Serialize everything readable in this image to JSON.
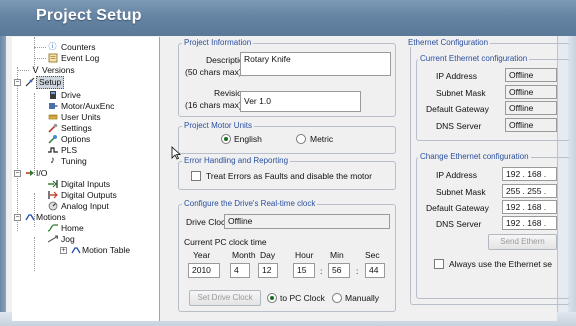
{
  "window": {
    "title": "Project Setup"
  },
  "tree": {
    "items": [
      {
        "label": "Counters",
        "icon": "info-icon"
      },
      {
        "label": "Event Log",
        "icon": "log-icon"
      },
      {
        "label": "Versions",
        "icon": "versions-icon"
      },
      {
        "label": "Setup",
        "icon": "setup-icon",
        "selected": true
      },
      {
        "label": "Drive",
        "icon": "drive-icon"
      },
      {
        "label": "Motor/AuxEnc",
        "icon": "motor-icon"
      },
      {
        "label": "User Units",
        "icon": "units-icon"
      },
      {
        "label": "Settings",
        "icon": "settings-icon"
      },
      {
        "label": "Options",
        "icon": "options-icon"
      },
      {
        "label": "PLS",
        "icon": "pls-icon"
      },
      {
        "label": "Tuning",
        "icon": "tuning-icon"
      },
      {
        "label": "I/O",
        "icon": "io-icon"
      },
      {
        "label": "Digital Inputs",
        "icon": "digital-inputs-icon"
      },
      {
        "label": "Digital Outputs",
        "icon": "digital-outputs-icon"
      },
      {
        "label": "Analog Input",
        "icon": "analog-input-icon"
      },
      {
        "label": "Motions",
        "icon": "motions-icon"
      },
      {
        "label": "Home",
        "icon": "home-icon"
      },
      {
        "label": "Jog",
        "icon": "jog-icon"
      },
      {
        "label": "Motion Table",
        "icon": "motion-table-icon"
      }
    ]
  },
  "project_info": {
    "legend": "Project Information",
    "description_label_1": "Description",
    "description_label_2": "(50 chars max)",
    "description_value": "Rotary Knife",
    "revision_label_1": "Revision",
    "revision_label_2": "(16 chars max)",
    "revision_value": "Ver 1.0"
  },
  "motor_units": {
    "legend": "Project Motor Units",
    "english": "English",
    "metric": "Metric",
    "selected": "English"
  },
  "error_handling": {
    "legend": "Error Handling and Reporting",
    "checkbox_label": "Treat Errors as Faults and disable the motor",
    "checked": false
  },
  "clock": {
    "legend": "Configure the Drive's Real-time clock",
    "drive_clock_label": "Drive Clock:",
    "drive_clock_value": "Offline",
    "current_label": "Current PC clock time",
    "headers": {
      "year": "Year",
      "month": "Month",
      "day": "Day",
      "hour": "Hour",
      "min": "Min",
      "sec": "Sec"
    },
    "values": {
      "year": "2010",
      "month": "4",
      "day": "12",
      "hour": "15",
      "min": "56",
      "sec": "44"
    },
    "colon": ":",
    "set_button": "Set Drive Clock",
    "to_pc": "to PC Clock",
    "manually": "Manually",
    "selected": "to PC Clock"
  },
  "ethernet": {
    "legend": "Ethernet Configuration",
    "current_legend": "Current Ethernet configuration",
    "ip_label": "IP Address",
    "subnet_label": "Subnet Mask",
    "gateway_label": "Default Gateway",
    "dns_label": "DNS Server",
    "current": {
      "ip": "Offline",
      "subnet": "Offline",
      "gateway": "Offline",
      "dns": "Offline"
    },
    "change_legend": "Change Ethernet configuration",
    "change": {
      "ip": "192 . 168 .",
      "subnet": "255 . 255 .",
      "gateway": "192 . 168 .",
      "dns": "192 . 168 ."
    },
    "send_button": "Send Ethern",
    "always_label": "Always use the Ethernet se",
    "always_checked": false
  },
  "colors": {
    "titlebar": "#6584a4",
    "legend_text": "#2a4fa0",
    "radio_dot": "#1b6e1b"
  }
}
